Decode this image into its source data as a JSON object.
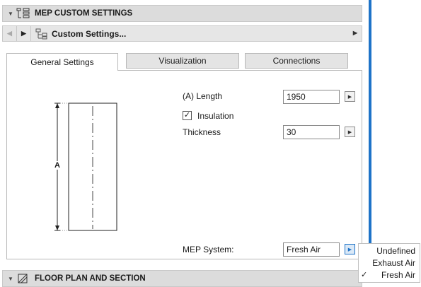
{
  "mep_section": {
    "title": "MEP CUSTOM SETTINGS",
    "icon": "mep-settings-icon",
    "collapse_icon": "collapse-arrow-icon"
  },
  "nav": {
    "prev_icon": "prev-arrow-icon",
    "next_icon": "next-arrow-icon",
    "item_icon": "custom-settings-icon",
    "label": "Custom Settings...",
    "more_icon": "submenu-arrow-icon"
  },
  "tabs": [
    {
      "label": "General Settings",
      "active": true
    },
    {
      "label": "Visualization",
      "active": false
    },
    {
      "label": "Connections",
      "active": false
    }
  ],
  "preview": {
    "dimension_label": "A"
  },
  "fields": {
    "length_label": "(A) Length",
    "length_value": "1950",
    "insulation_label": "Insulation",
    "insulation_checked": true,
    "thickness_label": "Thickness",
    "thickness_value": "30",
    "system_label": "MEP System:",
    "system_value": "Fresh Air"
  },
  "dropdown": {
    "options": [
      {
        "label": "Undefined",
        "checked": false
      },
      {
        "label": "Exhaust Air",
        "checked": false
      },
      {
        "label": "Fresh Air",
        "checked": true
      }
    ],
    "check_mark": "✓"
  },
  "footer_section": {
    "title": "FLOOR PLAN AND SECTION",
    "icon": "floor-plan-icon"
  },
  "colors": {
    "accent": "#1e73c8",
    "header_bg": "#dcdcdc",
    "tab_bg": "#e4e4e4"
  }
}
